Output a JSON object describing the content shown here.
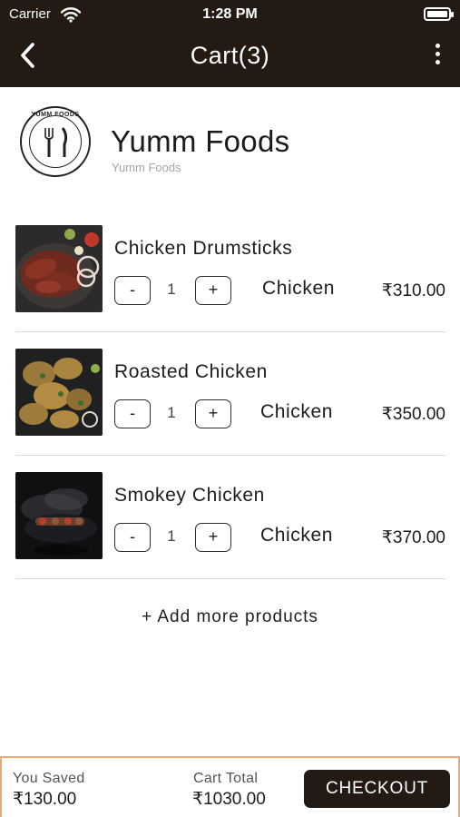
{
  "status_bar": {
    "carrier": "Carrier",
    "time": "1:28 PM"
  },
  "nav": {
    "title": "Cart(3)",
    "back_icon": "chevron-left-icon",
    "more_icon": "more-vertical-icon"
  },
  "restaurant": {
    "logo_text": "YUMM FOODS",
    "name": "Yumm Foods",
    "subtitle": "Yumm Foods"
  },
  "cart_items": [
    {
      "name": "Chicken Drumsticks",
      "quantity": "1",
      "category": "Chicken",
      "price": "₹310.00",
      "minus": "-",
      "plus": "+"
    },
    {
      "name": "Roasted Chicken",
      "quantity": "1",
      "category": "Chicken",
      "price": "₹350.00",
      "minus": "-",
      "plus": "+"
    },
    {
      "name": "Smokey Chicken",
      "quantity": "1",
      "category": "Chicken",
      "price": "₹370.00",
      "minus": "-",
      "plus": "+"
    }
  ],
  "add_more": "+ Add more products",
  "summary": {
    "saved_label": "You Saved",
    "saved_value": "₹130.00",
    "total_label": "Cart Total",
    "total_value": "₹1030.00",
    "checkout_label": "CHECKOUT"
  },
  "colors": {
    "header_bg": "#241a14",
    "bottom_border": "#e9a878"
  }
}
